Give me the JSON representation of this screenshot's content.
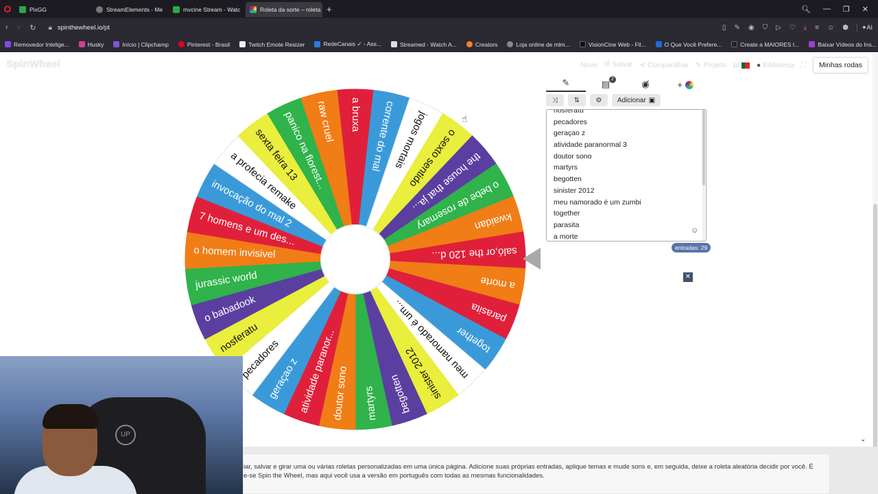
{
  "browser": {
    "tabs": [
      {
        "label": "PixGG",
        "color": "#2ea44f"
      },
      {
        "label": "StreamElements - Me",
        "color": "#555"
      },
      {
        "label": "mvcine Stream - Watc",
        "color": "#2ba84a"
      },
      {
        "label": "Roleta da sorte – roleta c",
        "color": "#e04a7c",
        "active": true
      }
    ],
    "url": "spinthewheel.io/pt",
    "bookmarks": [
      {
        "label": "Removedor Intelige...",
        "color": "#7a4de8"
      },
      {
        "label": "Husky",
        "color": "#d43f8d"
      },
      {
        "label": "Início | Clipchamp",
        "color": "#7d56d6"
      },
      {
        "label": "Pinterest - Brasil",
        "color": "#e60023"
      },
      {
        "label": "Twitch Emote Resizer",
        "color": "#eee"
      },
      {
        "label": "RedeCanais ✓ - Ass...",
        "color": "#2a7de1"
      },
      {
        "label": "Streamed - Watch A...",
        "color": "#ddd"
      },
      {
        "label": "Creators",
        "color": "#f58220"
      },
      {
        "label": "Loja online de mlm...",
        "color": "#888"
      },
      {
        "label": "VisionCine Web - Fil...",
        "color": "#111"
      },
      {
        "label": "O Que Você Prefere...",
        "color": "#1e6ad6"
      },
      {
        "label": "Create a MAIORES I...",
        "color": "#222"
      },
      {
        "label": "Baixar Vídeos do Ins...",
        "color": "#9b3fd6"
      }
    ]
  },
  "site": {
    "logo": "SpinWheel",
    "menu": {
      "new": "Novo",
      "save": "Salvar",
      "share": "Compartilhar",
      "project": "Projeto",
      "lang": "pt",
      "library": "Biblioteca",
      "my_wheels": "Minhas rodas"
    }
  },
  "wheel": {
    "segments": [
      {
        "label": "a bruxa",
        "color": "#e0203a"
      },
      {
        "label": "corrente do mal",
        "color": "#3a9ad9"
      },
      {
        "label": "jogos mortais",
        "color": "#ffffff"
      },
      {
        "label": "o sexto sentido",
        "color": "#eaee3c"
      },
      {
        "label": "the house that ja...",
        "color": "#5a3fa0"
      },
      {
        "label": "o bebe de rosemary",
        "color": "#2fb34a"
      },
      {
        "label": "kwaidan",
        "color": "#f07d16"
      },
      {
        "label": "saló,or the 120 d...",
        "color": "#e0203a"
      },
      {
        "label": "a morte",
        "color": "#f07d16"
      },
      {
        "label": "parasita",
        "color": "#e0203a"
      },
      {
        "label": "together",
        "color": "#3a9ad9"
      },
      {
        "label": "meu namorado é um...",
        "color": "#ffffff"
      },
      {
        "label": "sinister 2012",
        "color": "#eaee3c"
      },
      {
        "label": "begotten",
        "color": "#5a3fa0"
      },
      {
        "label": "martyrs",
        "color": "#2fb34a"
      },
      {
        "label": "doutor sono",
        "color": "#f07d16"
      },
      {
        "label": "atividade paranor...",
        "color": "#e0203a"
      },
      {
        "label": "geraçao z",
        "color": "#3a9ad9"
      },
      {
        "label": "pecadores",
        "color": "#ffffff"
      },
      {
        "label": "nosferatu",
        "color": "#eaee3c"
      },
      {
        "label": "o babadook",
        "color": "#5a3fa0"
      },
      {
        "label": "jurassic world",
        "color": "#2fb34a"
      },
      {
        "label": "o homem invisivel",
        "color": "#f07d16"
      },
      {
        "label": "7 homens e um des...",
        "color": "#e0203a"
      },
      {
        "label": "invocação do mal 2",
        "color": "#3a9ad9"
      },
      {
        "label": "a profecia remake",
        "color": "#ffffff"
      },
      {
        "label": "sexta feira 13",
        "color": "#eaee3c"
      },
      {
        "label": "panico na florest...",
        "color": "#2fb34a"
      },
      {
        "label": "raw cruel",
        "color": "#f07d16"
      }
    ]
  },
  "editor": {
    "add_label": "Adicionar",
    "badge": "2",
    "entries": [
      "nosferatu",
      "pecadores",
      "geraçao z",
      "atividade paranormal 3",
      "doutor sono",
      "martyrs",
      "begotten",
      "sinister 2012",
      "meu namorado é um  zumbi",
      "together",
      "parasita",
      "a morte"
    ],
    "count_label": "entradas: 29"
  },
  "description": {
    "line1": "iar, salvar e girar uma ou várias roletas personalizadas em uma única página. Adicione suas próprias entradas, aplique temas e mude sons e, em seguida, deixe a roleta aleatória decidir por você. É",
    "line2": "e-se Spin the Wheel, mas aqui você usa a versão em português com todas as mesmas funcionalidades."
  }
}
